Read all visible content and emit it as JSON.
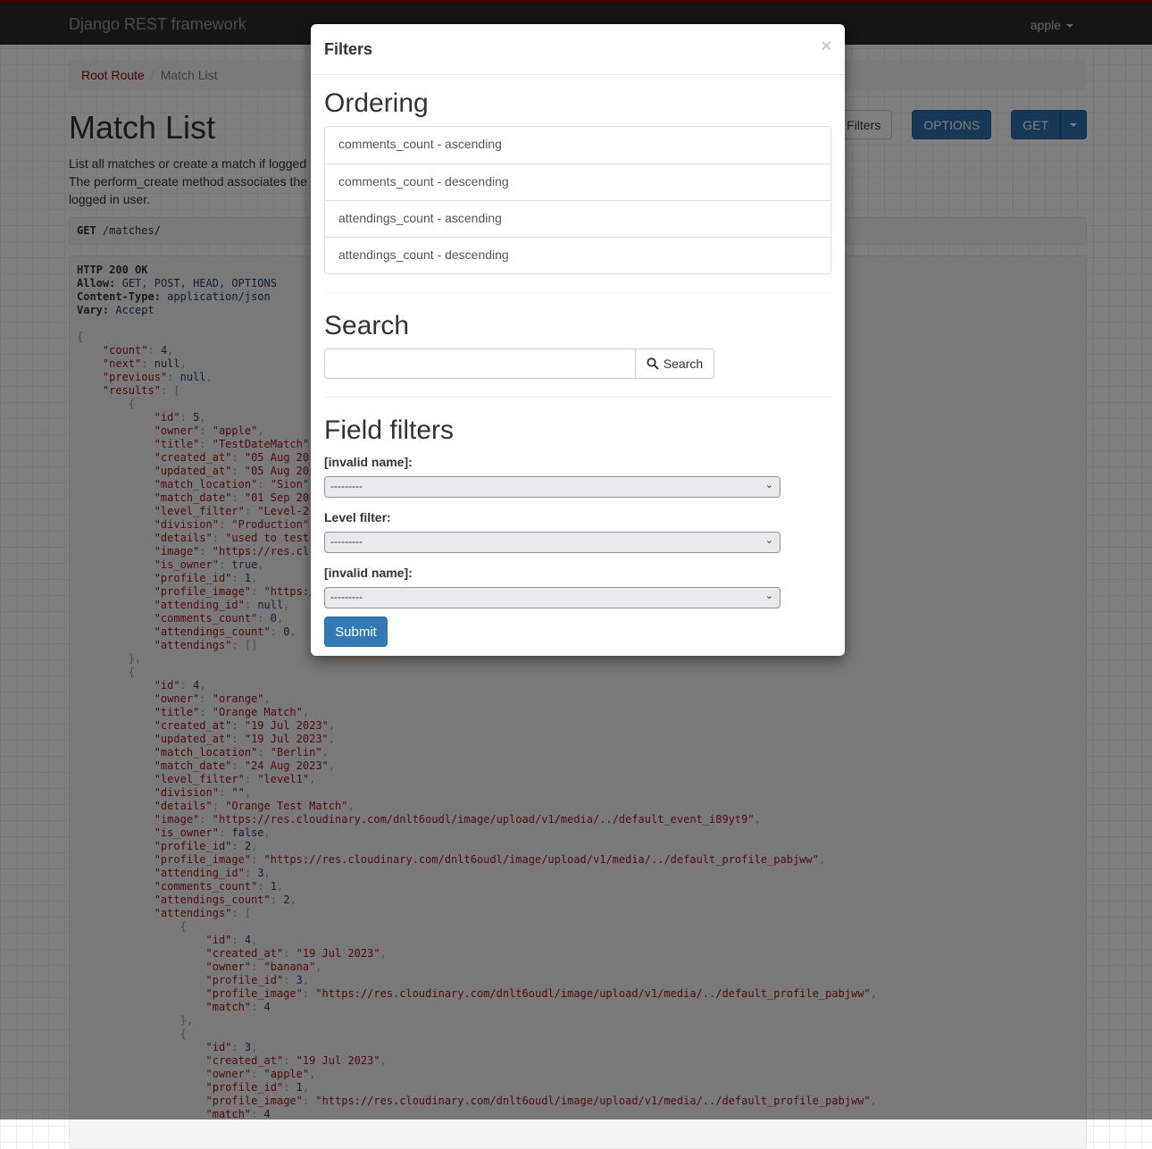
{
  "navbar": {
    "brand": "Django REST framework",
    "user": "apple"
  },
  "breadcrumb": {
    "root": "Root Route",
    "current": "Match List"
  },
  "page": {
    "title": "Match List",
    "description": [
      "List all matches or create a match if logged",
      "The perform_create method associates the",
      "logged in user."
    ]
  },
  "toolbar": {
    "filters": "Filters",
    "options": "OPTIONS",
    "get": "GET"
  },
  "request": {
    "method": "GET",
    "path": "/matches/"
  },
  "response": {
    "headers": [
      {
        "k": "HTTP 200 OK",
        "v": ""
      },
      {
        "k": "Allow:",
        "v": "GET, POST, HEAD, OPTIONS"
      },
      {
        "k": "Content-Type:",
        "v": "application/json"
      },
      {
        "k": "Vary:",
        "v": "Accept"
      }
    ],
    "body": [
      "{",
      "    \"count\": 4,",
      "    \"next\": null,",
      "    \"previous\": null,",
      "    \"results\": [",
      "        {",
      "            \"id\": 5,",
      "            \"owner\": \"apple\",",
      "            \"title\": \"TestDateMatch\",",
      "            \"created_at\": \"05 Aug 20",
      "            \"updated_at\": \"05 Aug 20",
      "            \"match_location\": \"Sion\",",
      "            \"match_date\": \"01 Sep 20",
      "            \"level_filter\": \"Level-2\"",
      "            \"division\": \"Production\",",
      "            \"details\": \"used to test",
      "            \"image\": \"https://res.cl",
      "            \"is_owner\": true,",
      "            \"profile_id\": 1,",
      "            \"profile_image\": \"https:/",
      "            \"attending_id\": null,",
      "            \"comments_count\": 0,",
      "            \"attendings_count\": 0,",
      "            \"attendings\": []",
      "        },",
      "        {",
      "            \"id\": 4,",
      "            \"owner\": \"orange\",",
      "            \"title\": \"Orange Match\",",
      "            \"created_at\": \"19 Jul 2023\",",
      "            \"updated_at\": \"19 Jul 2023\",",
      "            \"match_location\": \"Berlin\",",
      "            \"match_date\": \"24 Aug 2023\",",
      "            \"level_filter\": \"level1\",",
      "            \"division\": \"\",",
      "            \"details\": \"Orange Test Match\",",
      "            \"image\": \"https://res.cloudinary.com/dnlt6oudl/image/upload/v1/media/../default_event_i89yt9\",",
      "            \"is_owner\": false,",
      "            \"profile_id\": 2,",
      "            \"profile_image\": \"https://res.cloudinary.com/dnlt6oudl/image/upload/v1/media/../default_profile_pabjww\",",
      "            \"attending_id\": 3,",
      "            \"comments_count\": 1,",
      "            \"attendings_count\": 2,",
      "            \"attendings\": [",
      "                {",
      "                    \"id\": 4,",
      "                    \"created_at\": \"19 Jul 2023\",",
      "                    \"owner\": \"banana\",",
      "                    \"profile_id\": 3,",
      "                    \"profile_image\": \"https://res.cloudinary.com/dnlt6oudl/image/upload/v1/media/../default_profile_pabjww\",",
      "                    \"match\": 4",
      "                },",
      "                {",
      "                    \"id\": 3,",
      "                    \"created_at\": \"19 Jul 2023\",",
      "                    \"owner\": \"apple\",",
      "                    \"profile_id\": 1,",
      "                    \"profile_image\": \"https://res.cloudinary.com/dnlt6oudl/image/upload/v1/media/../default_profile_pabjww\",",
      "                    \"match\": 4"
    ]
  },
  "modal": {
    "title": "Filters",
    "close": "×",
    "ordering": {
      "heading": "Ordering",
      "items": [
        "comments_count - ascending",
        "comments_count - descending",
        "attendings_count - ascending",
        "attendings_count - descending"
      ]
    },
    "search": {
      "heading": "Search",
      "value": "",
      "button": "Search"
    },
    "field_filters": {
      "heading": "Field filters",
      "fields": [
        {
          "label": "[invalid name]:",
          "value": "---------"
        },
        {
          "label": "Level filter:",
          "value": "---------"
        },
        {
          "label": "[invalid name]:",
          "value": "---------"
        }
      ]
    },
    "submit": "Submit"
  }
}
